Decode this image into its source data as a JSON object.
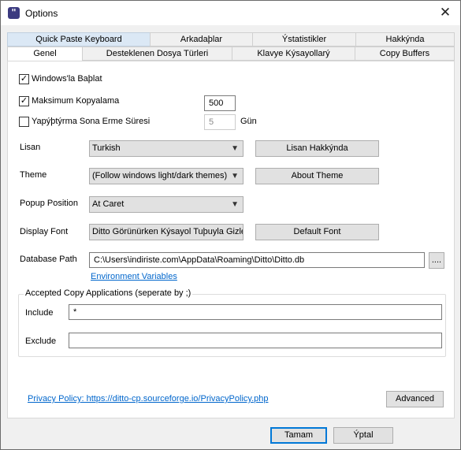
{
  "window": {
    "title": "Options",
    "icon": "ditto-app-icon",
    "close_glyph": "✕"
  },
  "tabs": {
    "row1": [
      "Quick Paste Keyboard",
      "Arkadaþlar",
      "Ýstatistikler",
      "Hakkýnda"
    ],
    "row2": [
      "Genel",
      "Desteklenen Dosya Türleri",
      "Klavye Kýsayollarý",
      "Copy Buffers"
    ]
  },
  "general": {
    "start_with_windows": {
      "label": "Windows'la Baþlat",
      "checked": true
    },
    "max_copies": {
      "label": "Maksimum Kopyalama",
      "checked": true,
      "value": "500"
    },
    "expire": {
      "label": "Yapýþtýrma Sona Erme Süresi",
      "checked": false,
      "value": "5",
      "unit": "Gün"
    },
    "language": {
      "label": "Lisan",
      "value": "Turkish",
      "button": "Lisan Hakkýnda"
    },
    "theme": {
      "label": "Theme",
      "value": "(Follow windows light/dark themes)",
      "button": "About Theme"
    },
    "popup_position": {
      "label": "Popup Position",
      "value": "At Caret"
    },
    "display_font": {
      "label": "Display Font",
      "value": "Ditto Görünürken Kýsayol Tuþuyla Gizle",
      "button": "Default Font"
    },
    "database_path": {
      "label": "Database Path",
      "value": "C:\\Users\\indiriste.com\\AppData\\Roaming\\Ditto\\Ditto.db",
      "browse": "....",
      "env_link": "Environment Variables"
    },
    "accepted_apps": {
      "legend": "Accepted Copy Applications (seperate by ;)",
      "include_label": "Include",
      "include_value": "*",
      "exclude_label": "Exclude",
      "exclude_value": ""
    },
    "privacy_link": "Privacy Policy: https://ditto-cp.sourceforge.io/PrivacyPolicy.php",
    "advanced_button": "Advanced"
  },
  "footer": {
    "ok": "Tamam",
    "cancel": "Ýptal"
  },
  "icons": {
    "dropdown": "chevron-down-icon",
    "check": "✓"
  }
}
